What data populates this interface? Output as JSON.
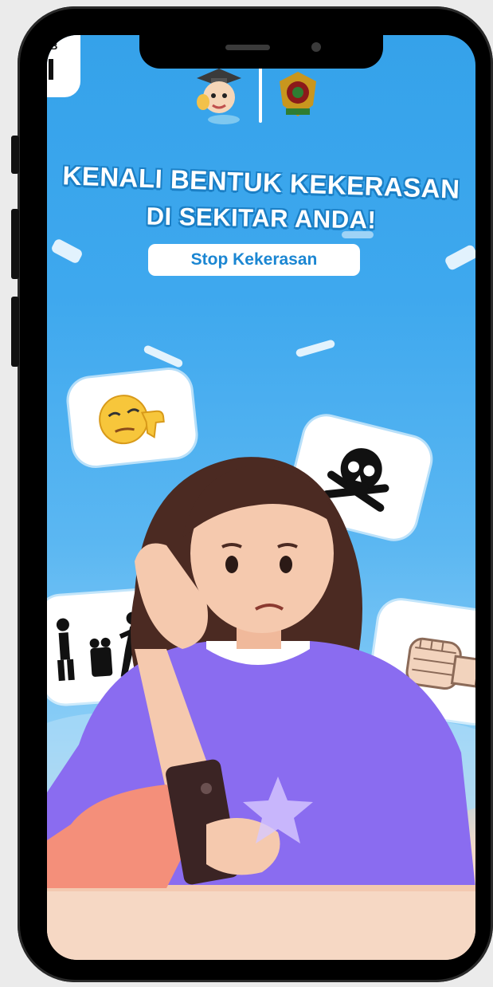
{
  "poster": {
    "title_line_1": "KENALI BENTUK KEKERASAN",
    "title_line_2": "DI SEKITAR ANDA!",
    "stop_label": "Stop Kekerasan",
    "corner_logo_text": "B"
  },
  "colors": {
    "sky": "#3ea8ee",
    "title_outline": "#1b7fc5",
    "pill_text": "#1b86d2",
    "shirt": "#8a6cf0",
    "hair": "#4b2a22",
    "skin": "#f5c9ae",
    "table": "#f6d8c4"
  },
  "icons": [
    "mascot-logo",
    "emblem-logo",
    "emoji-thumbs-down-icon",
    "skull-crossbones-icon",
    "violence-figures-icon",
    "fist-icon"
  ]
}
